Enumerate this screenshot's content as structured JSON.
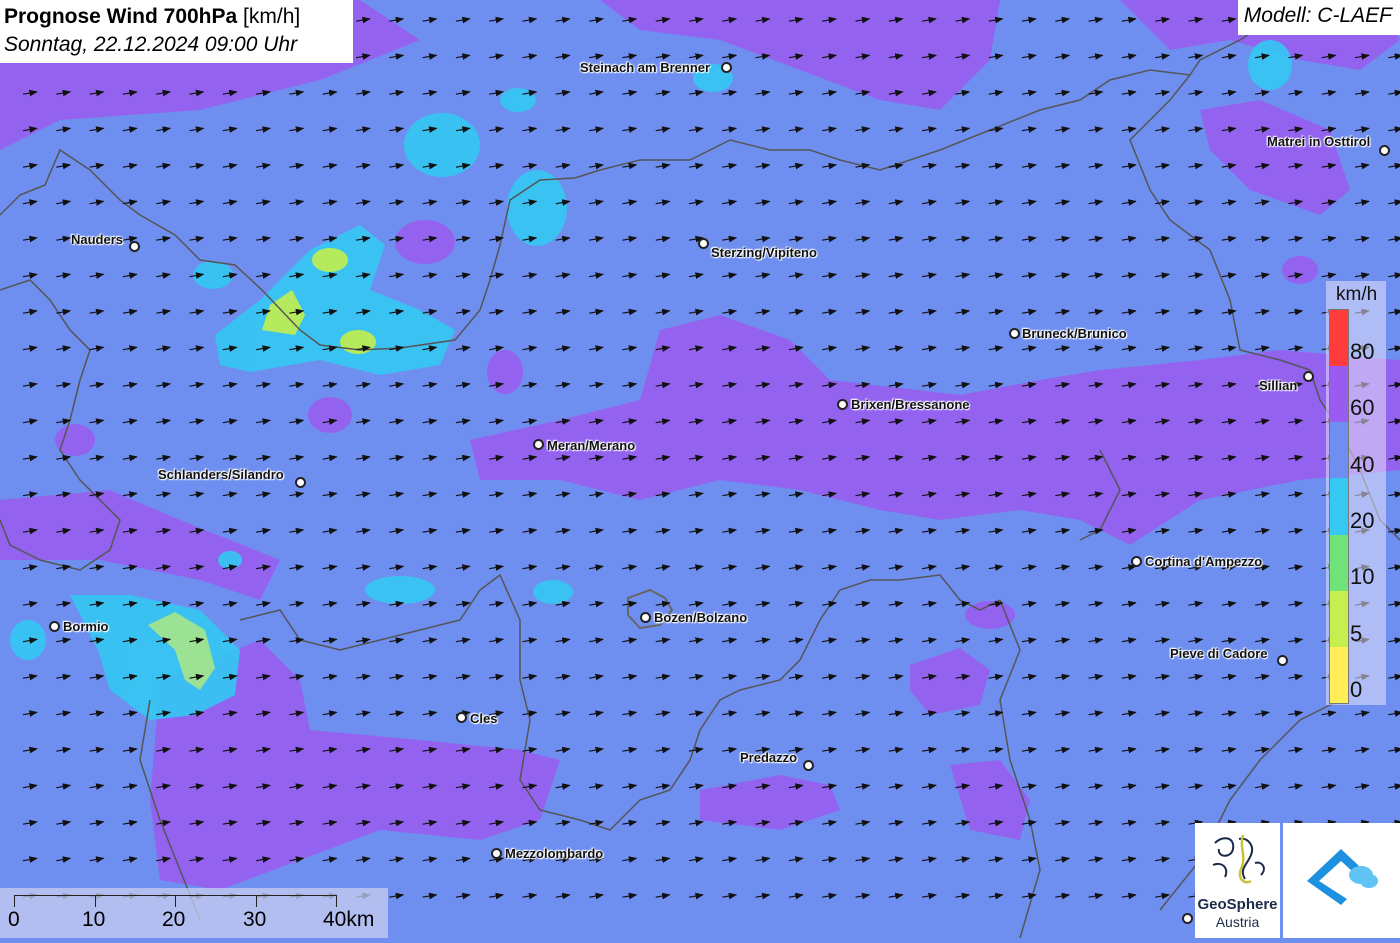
{
  "title": {
    "main": "Prognose Wind 700hPa",
    "unit": "[km/h]",
    "subtitle": "Sonntag, 22.12.2024 09:00 Uhr"
  },
  "model": "Modell: C-LAEF",
  "legend": {
    "unit": "km/h",
    "ticks": [
      "80",
      "60",
      "40",
      "20",
      "10",
      "5",
      "0"
    ],
    "colors": [
      "#ff3b3b",
      "#9a5cf0",
      "#6f8ff0",
      "#34c8f2",
      "#6fe27a",
      "#c4ef4f",
      "#ffee5a"
    ]
  },
  "scale": {
    "labels": [
      "0",
      "10",
      "20",
      "30",
      "40km"
    ]
  },
  "logos": {
    "geosphere_name": "GeoSphere",
    "geosphere_sub": "Austria"
  },
  "towns": [
    "Steinach am Brenner",
    "Matrei in Osttirol",
    "Nauders",
    "Sterzing/Vipiteno",
    "Bruneck/Brunico",
    "Sillian",
    "Brixen/Bressanone",
    "Meran/Merano",
    "Schlanders/Silandro",
    "Cortina d'Ampezzo",
    "Bormio",
    "Bozen/Bolzano",
    "Pieve di Cadore",
    "Cles",
    "Predazzo",
    "Mezzolombardo"
  ],
  "colors": {
    "wind_40_60": "#6f8ff0",
    "wind_60_80": "#9a5cf0",
    "wind_20_40": "#34c8f2",
    "wind_10_20": "#6fe27a",
    "wind_5_10": "#c4ef4f"
  }
}
